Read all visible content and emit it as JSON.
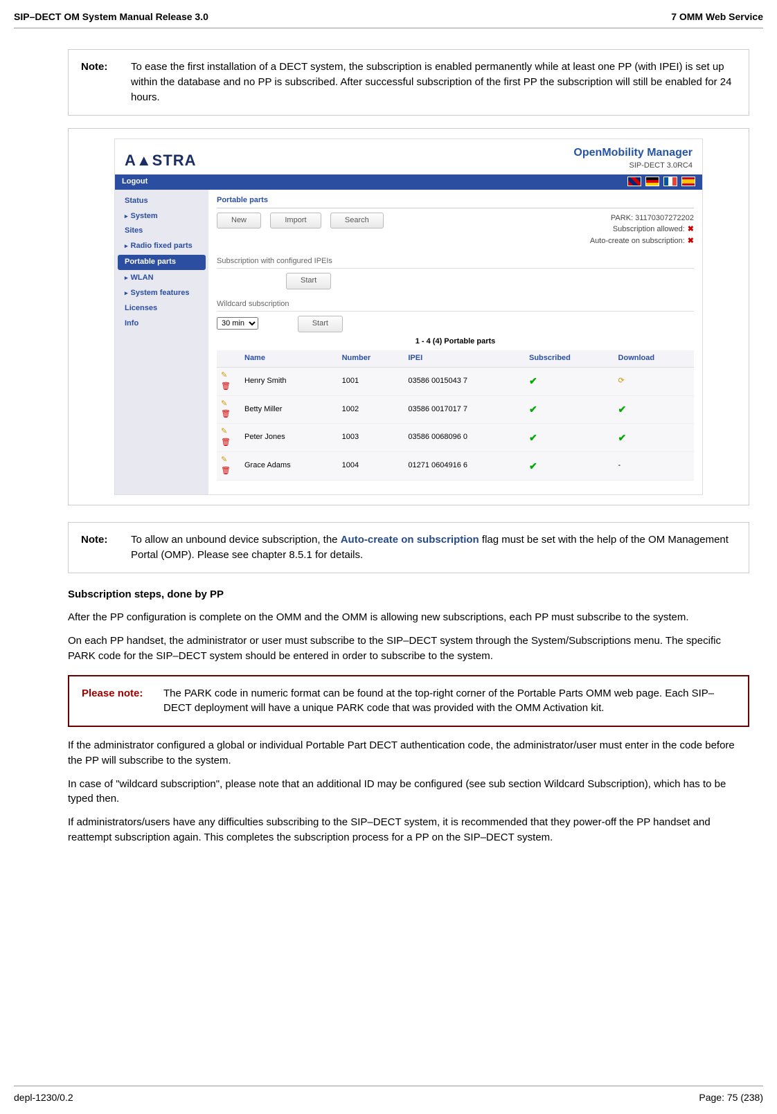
{
  "header": {
    "left": "SIP–DECT OM System Manual Release 3.0",
    "right": "7 OMM Web Service"
  },
  "note1": {
    "label": "Note:",
    "text": "To ease the first installation of a DECT system, the subscription is enabled permanently while at least one PP (with IPEI) is set up within the database and no PP is subscribed. After successful subscription of the first PP the subscription will still be enabled for 24 hours."
  },
  "omm": {
    "brand": "A▲STRA",
    "title1": "OpenMobility Manager",
    "title2": "SIP-DECT 3.0RC4",
    "logout": "Logout",
    "nav": {
      "status": "Status",
      "system": "System",
      "sites": "Sites",
      "rfp": "Radio fixed parts",
      "pp": "Portable parts",
      "wlan": "WLAN",
      "sysfeat": "System features",
      "licenses": "Licenses",
      "info": "Info"
    },
    "panel": {
      "title": "Portable parts",
      "btn_new": "New",
      "btn_import": "Import",
      "btn_search": "Search",
      "park": "PARK: 31170307272202",
      "sub_allowed": "Subscription allowed:",
      "auto_create": "Auto-create on subscription:",
      "sec1": "Subscription with configured IPEIs",
      "btn_start1": "Start",
      "sec2": "Wildcard subscription",
      "dur_opt": "30 min",
      "btn_start2": "Start",
      "table_caption": "1 - 4 (4) Portable parts",
      "cols": {
        "name": "Name",
        "number": "Number",
        "ipei": "IPEI",
        "sub": "Subscribed",
        "dl": "Download"
      }
    },
    "rows": [
      {
        "name": "Henry Smith",
        "number": "1001",
        "ipei": "03586 0015043 7",
        "sub": "✔",
        "dl": "⟳"
      },
      {
        "name": "Betty Miller",
        "number": "1002",
        "ipei": "03586 0017017 7",
        "sub": "✔",
        "dl": "✔"
      },
      {
        "name": "Peter Jones",
        "number": "1003",
        "ipei": "03586 0068096 0",
        "sub": "✔",
        "dl": "✔"
      },
      {
        "name": "Grace Adams",
        "number": "1004",
        "ipei": "01271 0604916 6",
        "sub": "✔",
        "dl": "-"
      }
    ]
  },
  "note2": {
    "label": "Note:",
    "pre": "To allow an unbound device subscription, the ",
    "link": "Auto-create on subscription",
    "post": " flag must be set with the help of the OM Management Portal (OMP). Please see chapter 8.5.1 for details."
  },
  "body": {
    "h1": "Subscription steps, done by PP",
    "p1": "After the PP configuration is complete on the OMM and the OMM is allowing new subscriptions, each PP must subscribe to the system.",
    "p2": "On each PP handset, the administrator or user must subscribe to the SIP–DECT system through the System/Subscriptions menu. The specific PARK code for the SIP–DECT system should be entered in order to subscribe to the system."
  },
  "pleasenote": {
    "label": "Please note:",
    "text": "The PARK code in numeric format can be found at the top-right corner of the Portable Parts OMM web page. Each SIP–DECT deployment will have a unique PARK code that was provided with the OMM Activation kit."
  },
  "body2": {
    "p3": "If the administrator configured a global or individual Portable Part DECT authentication code, the administrator/user must enter in the code before the PP will subscribe to the system.",
    "p4": "In case of \"wildcard subscription\", please note that an additional ID may be configured (see sub section Wildcard Subscription), which has to be typed then.",
    "p5": "If administrators/users have any difficulties subscribing to the SIP–DECT system, it is recommended that they power-off the PP handset and reattempt subscription again. This completes the subscription process for a PP on the SIP–DECT system."
  },
  "footer": {
    "left": "depl-1230/0.2",
    "right": "Page: 75 (238)"
  }
}
